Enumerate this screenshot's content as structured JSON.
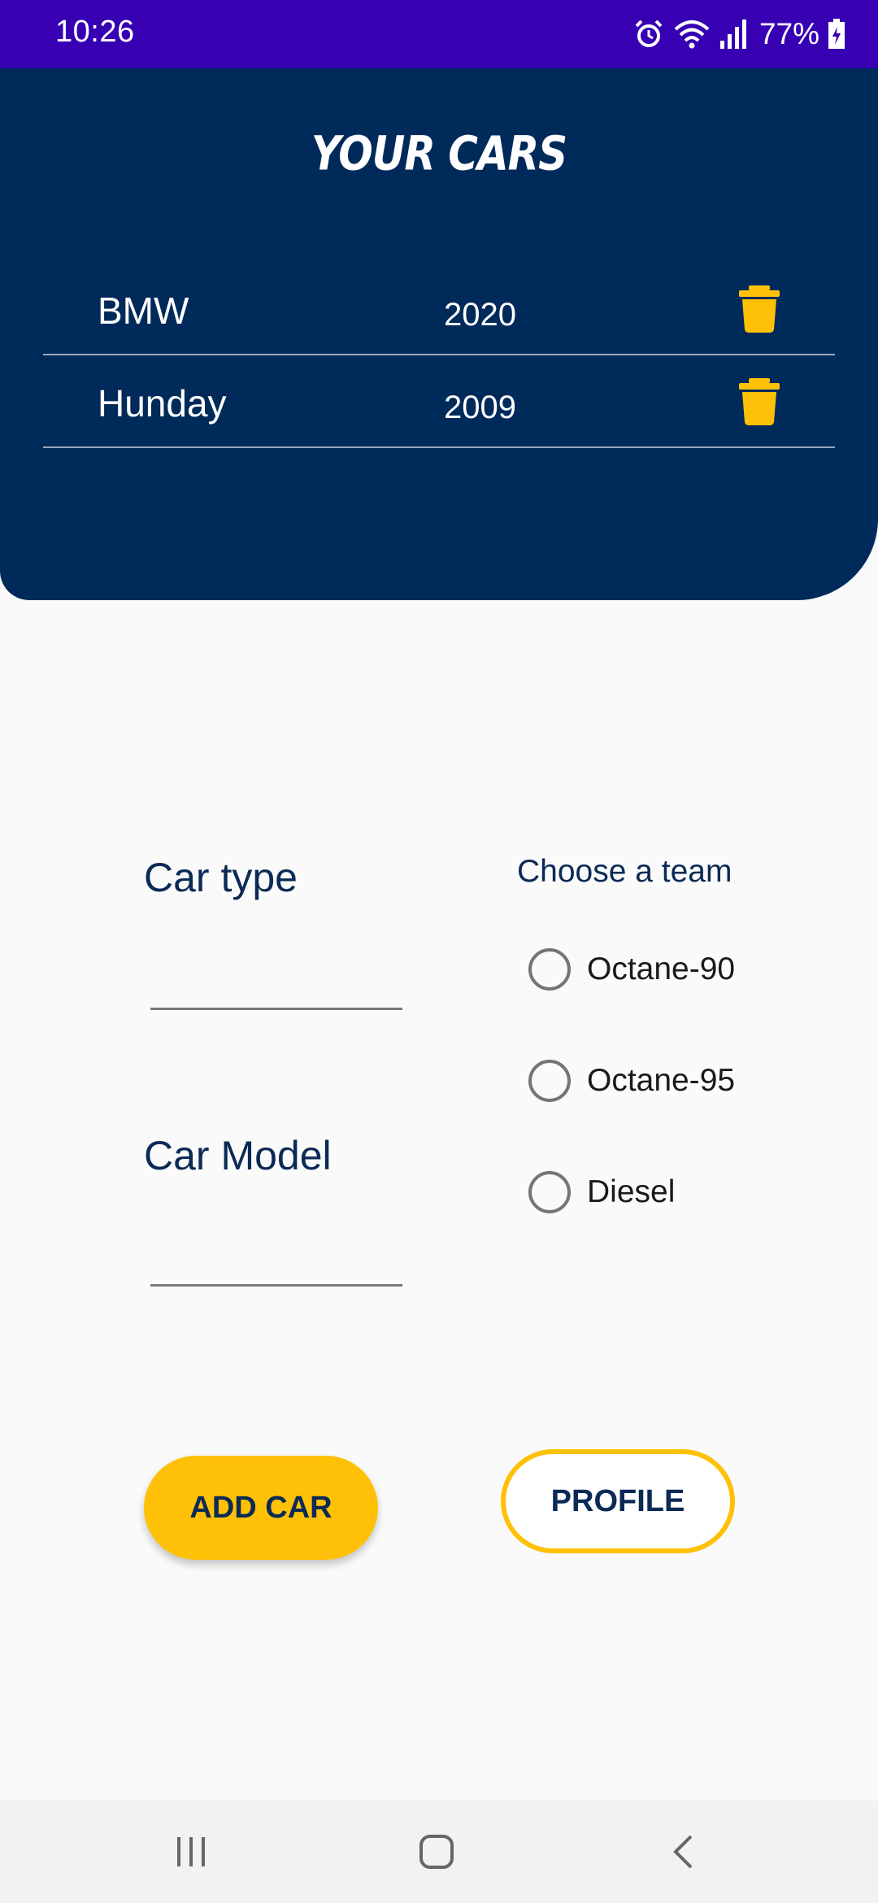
{
  "status_bar": {
    "time": "10:26",
    "battery": "77%",
    "icons": [
      "alarm-icon",
      "wifi-icon",
      "signal-icon",
      "battery-charging-icon"
    ]
  },
  "header": {
    "title": "YOUR CARS",
    "cars": [
      {
        "name": "BMW",
        "year": "2020",
        "icon": "trash-icon"
      },
      {
        "name": "Hunday",
        "year": "2009",
        "icon": "trash-icon"
      }
    ]
  },
  "form": {
    "car_type_label": "Car type",
    "car_type_value": "",
    "car_model_label": "Car Model",
    "car_model_value": "",
    "team_title": "Choose a team",
    "options": [
      "Octane-90",
      "Octane-95",
      "Diesel"
    ]
  },
  "buttons": {
    "add_car": "ADD CAR",
    "profile": "PROFILE"
  },
  "nav": {
    "icons": [
      "recents-icon",
      "home-icon",
      "back-icon"
    ]
  },
  "colors": {
    "status_bar": "#3700b3",
    "header_bg": "#002a5a",
    "accent": "#ffc107",
    "text_dark": "#0b2a55"
  }
}
